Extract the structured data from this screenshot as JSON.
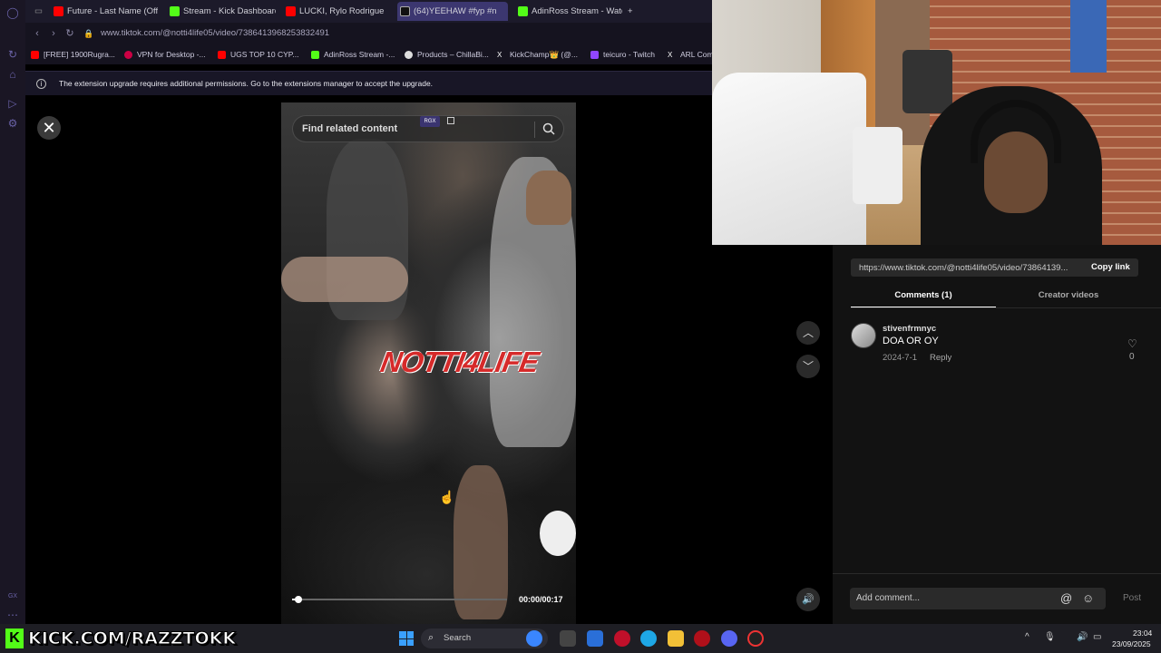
{
  "browser": {
    "tabs": [
      {
        "label": "Future - Last Name (Offic",
        "color": "#ff0000"
      },
      {
        "label": "Stream - Kick Dashboard",
        "color": "#53fc18"
      },
      {
        "label": "LUCKI, Rylo Rodrigue",
        "color": "#ff0000"
      },
      {
        "label": "(64)YEEHAW #fyp #n",
        "color": "#111111"
      },
      {
        "label": "AdinRoss Stream - Watch",
        "color": "#53fc18"
      }
    ],
    "new_tab": "+",
    "url": "www.tiktok.com/@notti4life05/video/7386413968253832491",
    "bookmarks": [
      {
        "label": "[FREE] 1900Rugra...",
        "color": "#ff0000"
      },
      {
        "label": "VPN for Desktop -...",
        "color": "#cc0044"
      },
      {
        "label": "UGS TOP 10 CYP...",
        "color": "#ff0000"
      },
      {
        "label": "AdinRoss Stream -...",
        "color": "#53fc18"
      },
      {
        "label": "Products – ChillaBi...",
        "color": "#dddddd"
      },
      {
        "label": "KickChamp👑 (@...",
        "color": "#ffffff"
      },
      {
        "label": "teicuro - Twitch",
        "color": "#9146ff"
      },
      {
        "label": "ARL Com",
        "color": "#ffffff"
      }
    ],
    "banner_text": "The extension upgrade requires additional permissions. Go to the extensions manager to accept the upgrade."
  },
  "video": {
    "search_placeholder": "Find related content",
    "rgx_label": "RGX",
    "overlay_logo": "NOTTI4LIFE",
    "time": "00:00/00:17",
    "progress": 0.03
  },
  "panel": {
    "link_url": "https://www.tiktok.com/@notti4life05/video/73864139...",
    "copy_link": "Copy link",
    "tab_comments": "Comments (1)",
    "tab_creator": "Creator videos",
    "comment": {
      "user": "stivenfrmnyc",
      "text": "DOA OR OY",
      "date": "2024-7-1",
      "reply": "Reply",
      "likes": "0"
    },
    "add_comment": "Add comment...",
    "post": "Post"
  },
  "taskbar": {
    "kick_text": "KICK.COM/RAZZTOKK",
    "search": "Search",
    "time": "23:04",
    "date": "23/09/2025"
  },
  "sidebar": {
    "gx_label": "GX"
  }
}
